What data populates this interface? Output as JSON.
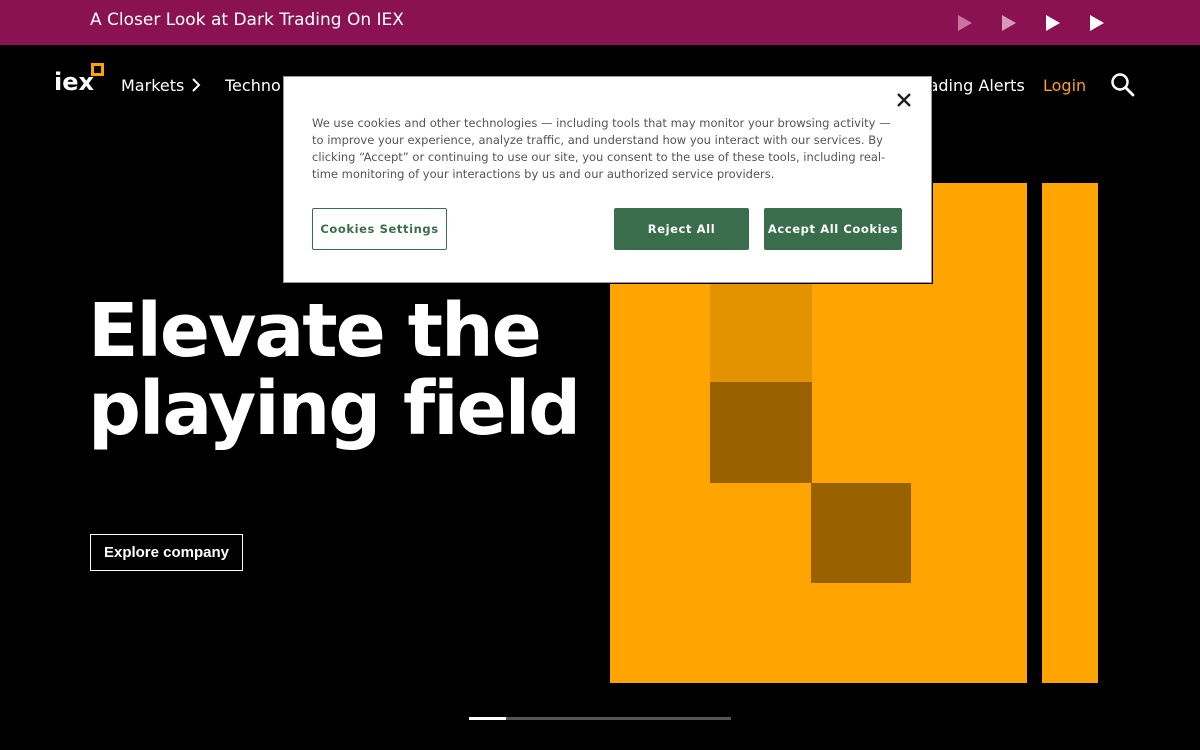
{
  "banner": {
    "text": "A Closer Look at Dark Trading On IEX",
    "background": "#8a1253"
  },
  "nav": {
    "logo_text": "iex",
    "items": [
      {
        "label": "Markets"
      },
      {
        "label": "Technol"
      },
      {
        "label": "rading Alerts"
      },
      {
        "label": "Login"
      }
    ],
    "login_color": "#f7a21b"
  },
  "hero": {
    "title_line1": "Elevate the",
    "title_line2": "playing field",
    "cta_label": "Explore company",
    "accent": "#ffa400"
  },
  "slider": {
    "progress": 0.14
  },
  "cookie_modal": {
    "text": "We use cookies and other technologies — including tools that may monitor your browsing activity — to improve your experience, analyze traffic, and understand how you interact with our services. By clicking “Accept” or continuing to use our site, you consent to the use of these tools, including real-time monitoring of your interactions by us and our authorized service providers.",
    "settings_label": "Cookies Settings",
    "reject_label": "Reject All",
    "accept_label": "Accept All Cookies",
    "button_color": "#3a6d4c"
  }
}
